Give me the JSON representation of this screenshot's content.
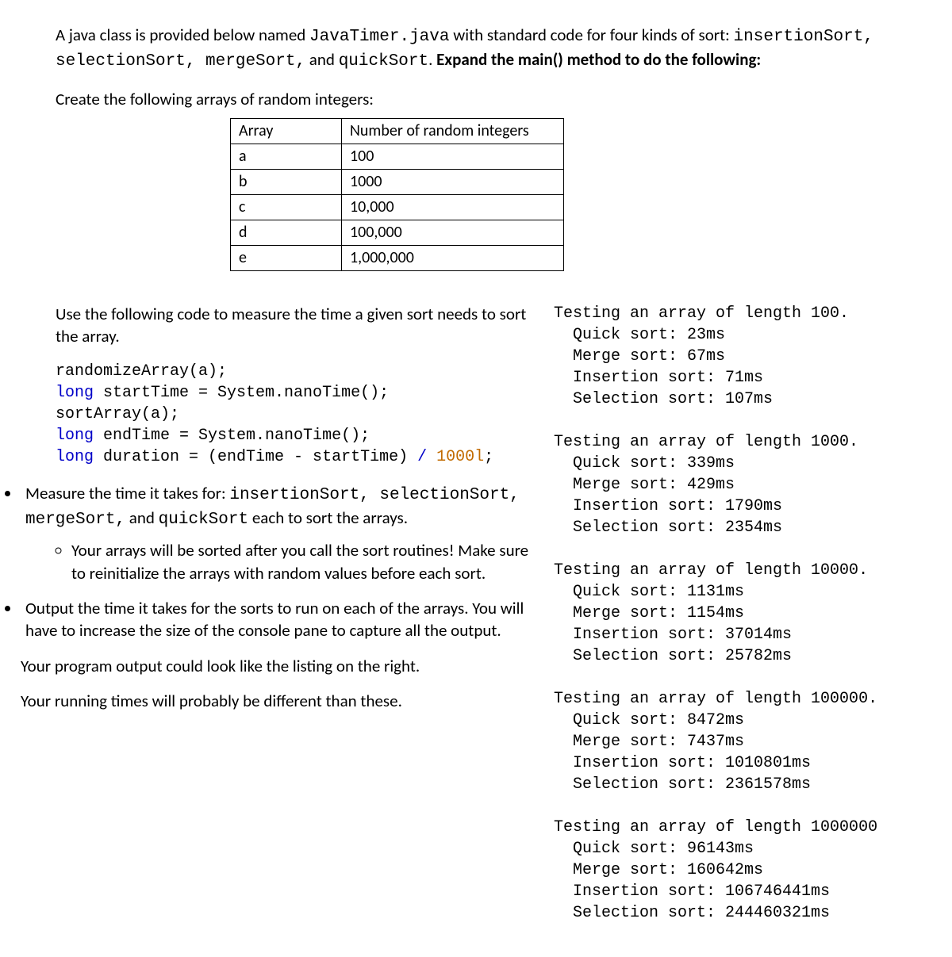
{
  "intro": {
    "pre": "A java class is provided below named ",
    "class_name": "JavaTimer.java",
    "mid": " with standard code for four kinds of sort: ",
    "sorts": "insertionSort, selectionSort, mergeSort,",
    "and": " and ",
    "quick": "quickSort",
    "period": ". ",
    "bold_tail": "Expand the main() method to do the following:"
  },
  "create_arrays_line": "Create the following arrays of random integers:",
  "table": {
    "h1": "Array",
    "h2": "Number of random integers",
    "rows": [
      {
        "a": "a",
        "n": "100"
      },
      {
        "a": "b",
        "n": "1000"
      },
      {
        "a": "c",
        "n": "10,000"
      },
      {
        "a": "d",
        "n": "100,000"
      },
      {
        "a": "e",
        "n": "1,000,000"
      }
    ]
  },
  "use_code_para": "Use  the following code to measure the time a given sort needs to sort the array.",
  "code": {
    "l1a": "randomizeArray(a);",
    "l2a": "long",
    "l2b": " startTime = System.nanoTime();",
    "l3a": "sortArray(a);",
    "l4a": "long",
    "l4b": " endTime = System.nanoTime();",
    "l5a": "long",
    "l5b": " duration = (endTime - startTime) ",
    "l5c": "/",
    "l5d": " 1000l",
    "l5e": ";"
  },
  "bullet1": {
    "pre": "Measure the time it takes for: ",
    "sorts": "insertionSort, selectionSort, mergeSort,",
    "and": " and ",
    "quick": "quickSort",
    "tail": " each to sort the arrays."
  },
  "sub1": "Your arrays will be sorted after you call the sort routines! Make sure to reinitialize the arrays with random values before each sort.",
  "bullet2": "Output the time it takes for the sorts to run on each of the arrays. You will have to increase the size of the console pane to capture all the output.",
  "tail1": "Your program output could look like the listing on the right.",
  "tail2": "Your running times will probably be different than these.",
  "output": [
    "Testing an array of length 100.",
    "  Quick sort: 23ms",
    "  Merge sort: 67ms",
    "  Insertion sort: 71ms",
    "  Selection sort: 107ms",
    "",
    "Testing an array of length 1000.",
    "  Quick sort: 339ms",
    "  Merge sort: 429ms",
    "  Insertion sort: 1790ms",
    "  Selection sort: 2354ms",
    "",
    "Testing an array of length 10000.",
    "  Quick sort: 1131ms",
    "  Merge sort: 1154ms",
    "  Insertion sort: 37014ms",
    "  Selection sort: 25782ms",
    "",
    "Testing an array of length 100000.",
    "  Quick sort: 8472ms",
    "  Merge sort: 7437ms",
    "  Insertion sort: 1010801ms",
    "  Selection sort: 2361578ms",
    "",
    "Testing an array of length 1000000",
    "  Quick sort: 96143ms",
    "  Merge sort: 160642ms",
    "  Insertion sort: 106746441ms",
    "  Selection sort: 244460321ms"
  ]
}
